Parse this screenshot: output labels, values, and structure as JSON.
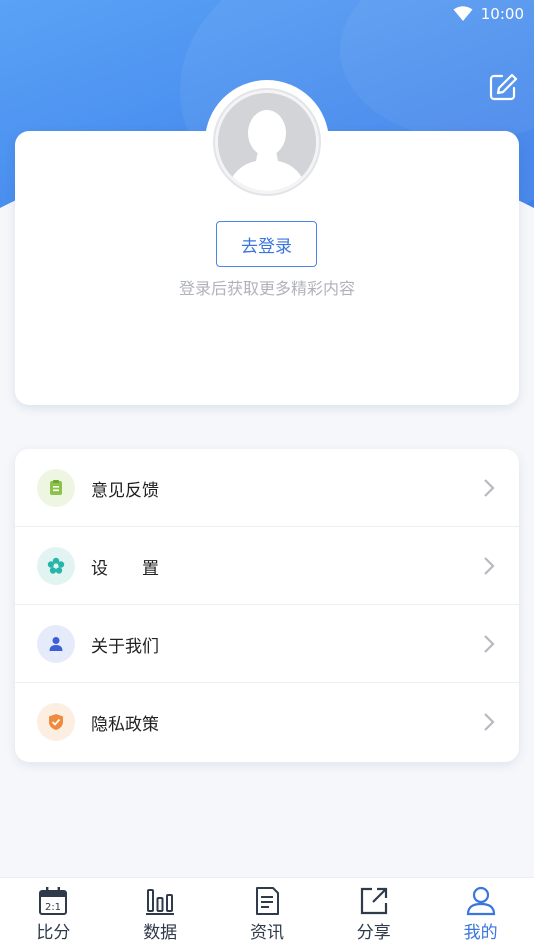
{
  "status_bar": {
    "time": "10:00"
  },
  "profile": {
    "login_button": "去登录",
    "hint": "登录后获取更多精彩内容"
  },
  "menu": {
    "items": [
      {
        "label": "意见反馈",
        "icon": "feedback-icon",
        "color": "#8bc34a"
      },
      {
        "label": "设　　置",
        "icon": "settings-icon",
        "color": "#26b5a8"
      },
      {
        "label": "关于我们",
        "icon": "about-icon",
        "color": "#3d5fd6"
      },
      {
        "label": "隐私政策",
        "icon": "privacy-icon",
        "color": "#f08a3c"
      }
    ]
  },
  "tabbar": {
    "tabs": [
      {
        "label": "比分",
        "icon": "calendar-score-icon",
        "badge": "2:1"
      },
      {
        "label": "数据",
        "icon": "bar-chart-icon"
      },
      {
        "label": "资讯",
        "icon": "news-icon"
      },
      {
        "label": "分享",
        "icon": "share-icon"
      },
      {
        "label": "我的",
        "icon": "user-icon",
        "active": true
      }
    ],
    "active_color": "#3a76de"
  }
}
